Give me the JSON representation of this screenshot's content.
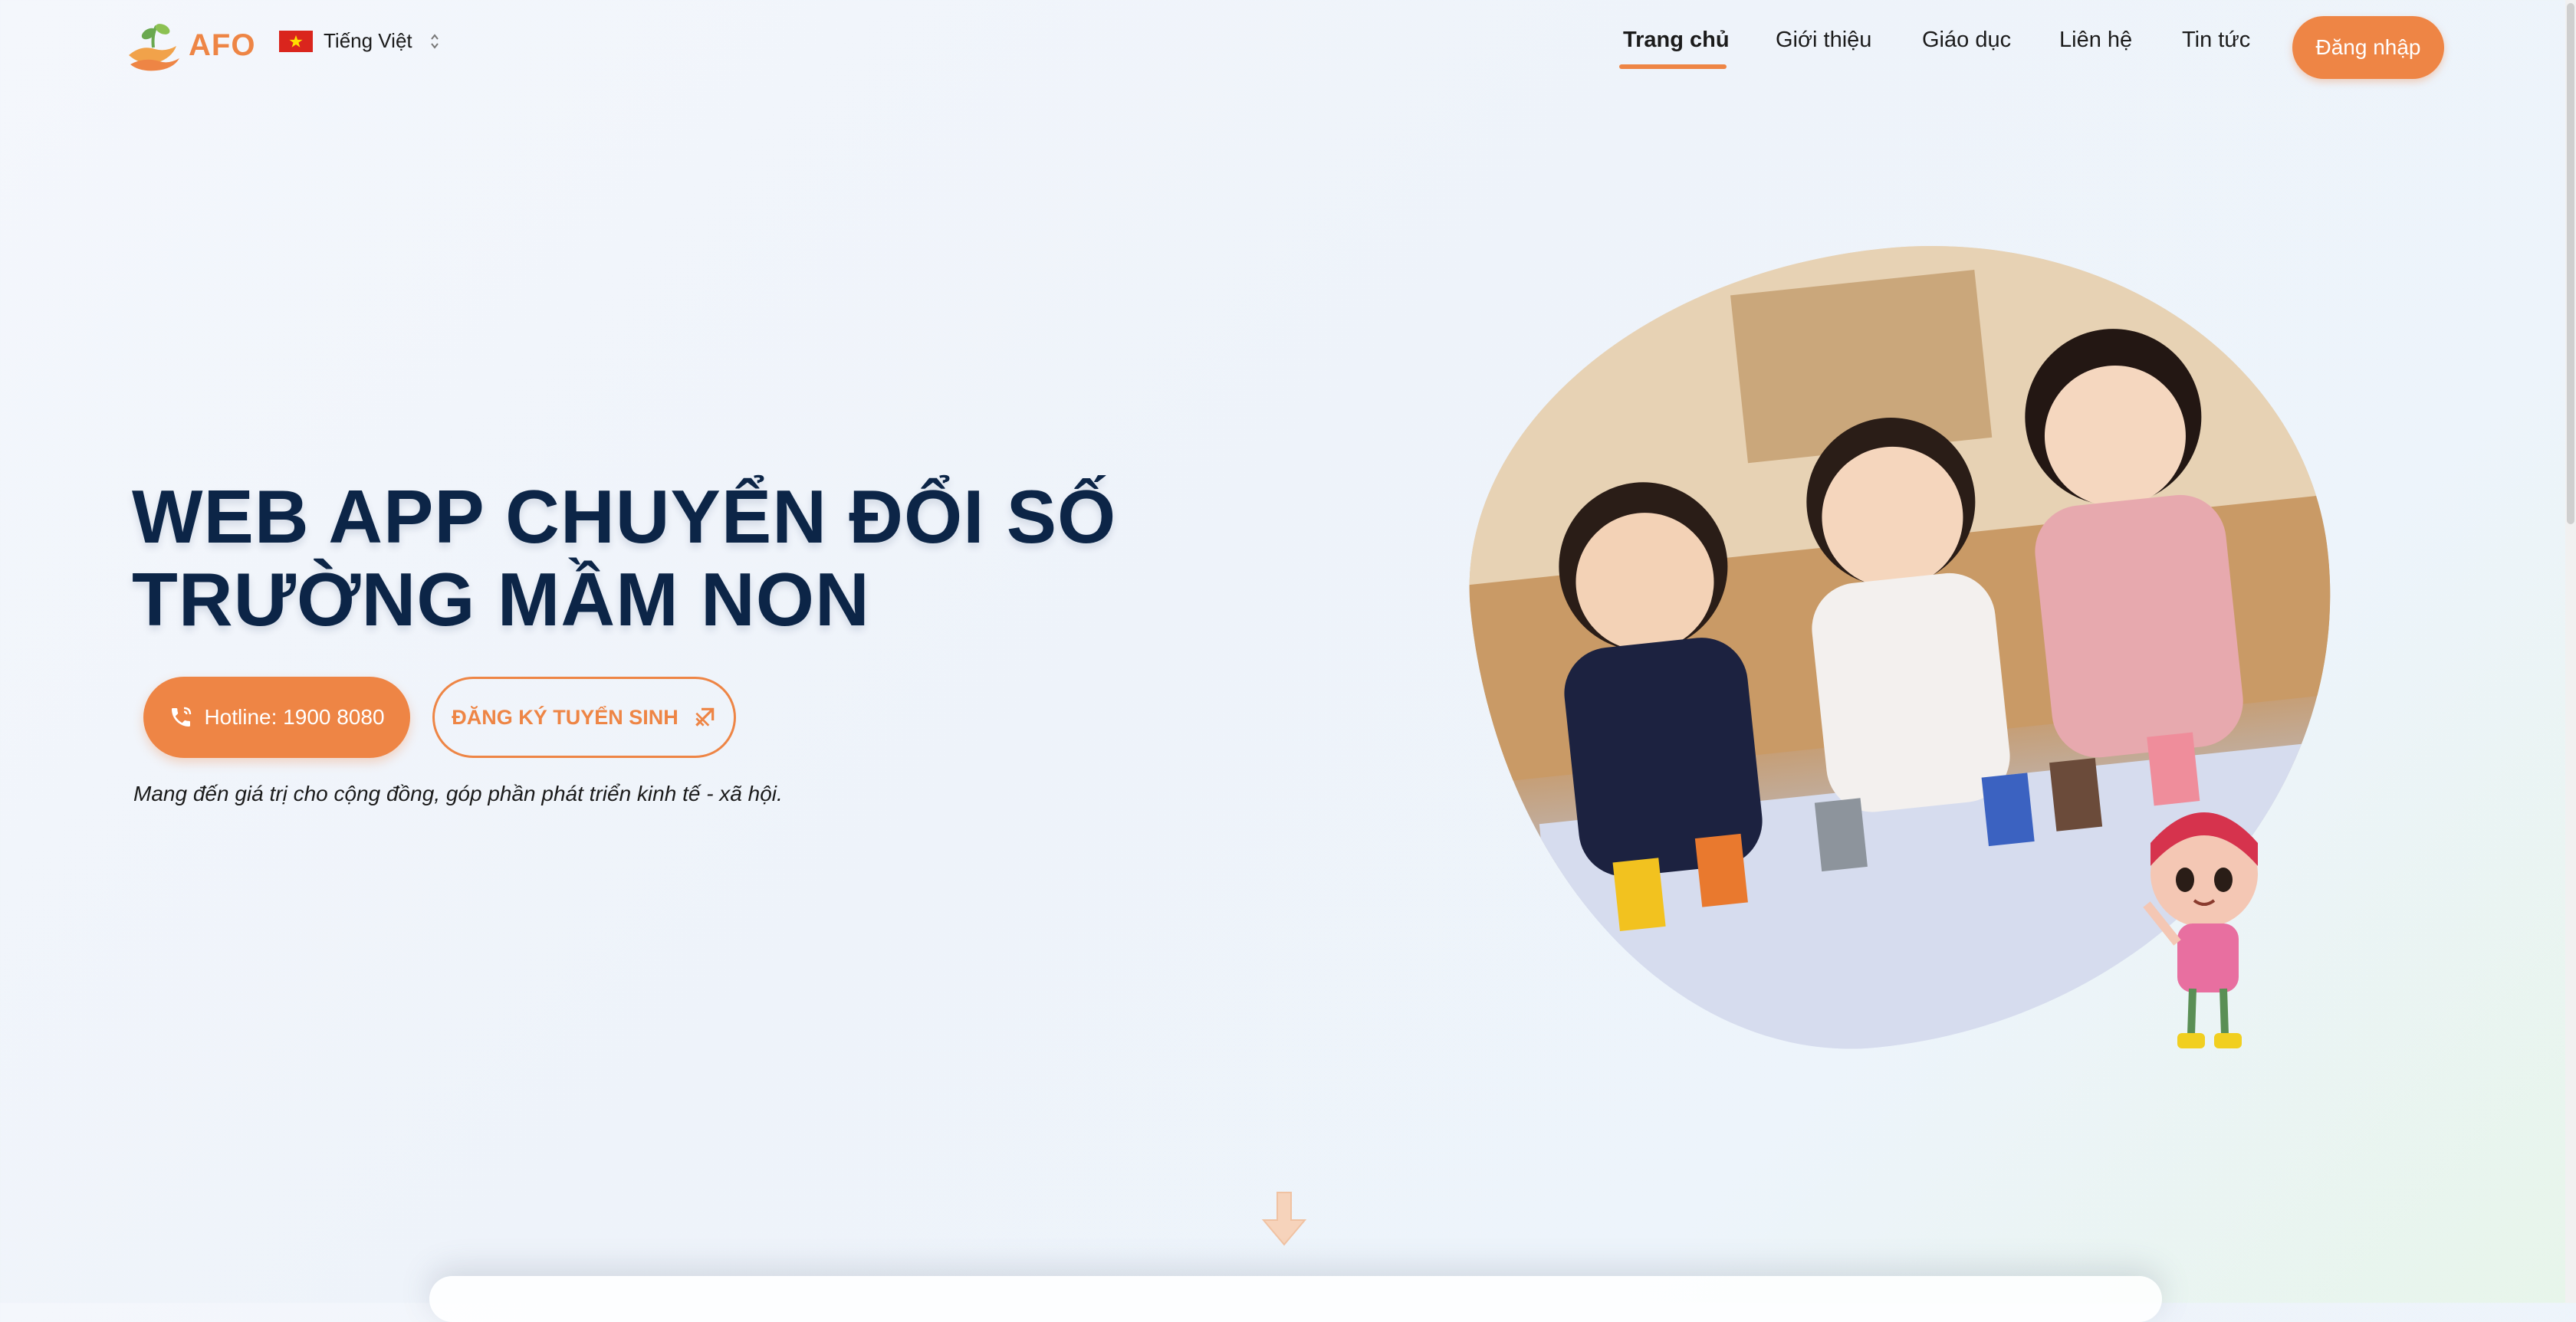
{
  "brand": {
    "name": "AFO",
    "color": "#ee8545"
  },
  "language": {
    "label": "Tiếng Việt",
    "flag": "vietnam-flag"
  },
  "nav": [
    {
      "label": "Trang chủ",
      "active": true
    },
    {
      "label": "Giới thiệu",
      "active": false
    },
    {
      "label": "Giáo dục",
      "active": false
    },
    {
      "label": "Liên hệ",
      "active": false
    },
    {
      "label": "Tin tức",
      "active": false
    }
  ],
  "login_label": "Đăng nhập",
  "hero": {
    "title_line1": "WEB APP CHUYỂN ĐỔI SỐ",
    "title_line2": "TRƯỜNG MẦM NON",
    "hotline_label": "Hotline: 1900 8080",
    "register_label": "ĐĂNG KÝ TUYỂN SINH",
    "tagline": "Mang đến giá trị cho cộng đồng, góp phần phát triển kinh tế - xã hội."
  },
  "colors": {
    "accent": "#ee8545",
    "title": "#0c2547",
    "text": "#1b1b1b"
  },
  "icons": {
    "phone": "phone-icon",
    "register": "arrow-diagonal-icon",
    "scroll": "arrow-down-icon"
  }
}
